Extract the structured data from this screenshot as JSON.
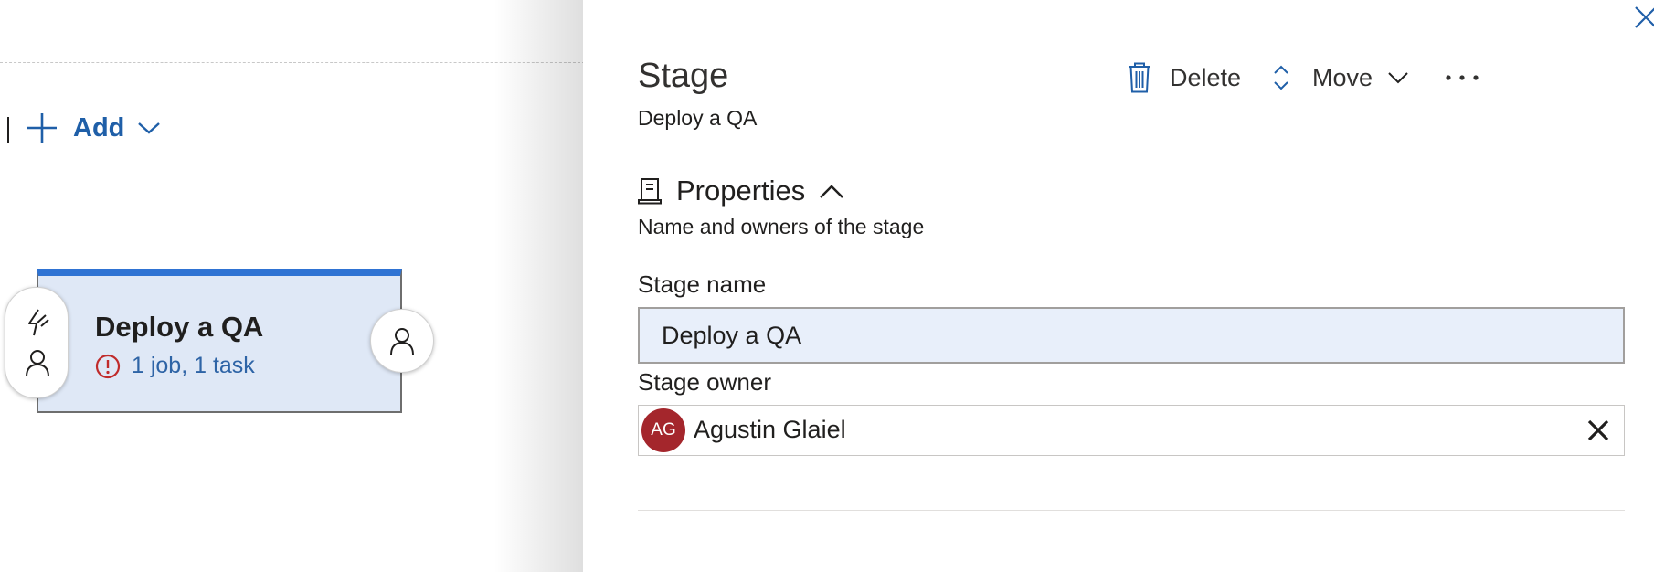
{
  "canvas": {
    "add_label": "Add",
    "stage_card": {
      "title": "Deploy a QA",
      "summary": "1 job, 1 task"
    },
    "icons": {
      "add": "plus-icon",
      "add_menu": "chevron-down-icon",
      "warning": "warning-circle-icon",
      "trigger": "lightning-icon",
      "pre_approval": "person-icon",
      "post_approval": "person-icon"
    }
  },
  "panel": {
    "title": "Stage",
    "subtitle": "Deploy a QA",
    "toolbar": {
      "delete_label": "Delete",
      "move_label": "Move"
    },
    "properties": {
      "heading": "Properties",
      "description": "Name and owners of the stage"
    },
    "stage_name": {
      "label": "Stage name",
      "value": "Deploy a QA"
    },
    "stage_owner": {
      "label": "Stage owner",
      "initials": "AG",
      "name": "Agustin Glaiel"
    }
  },
  "colors": {
    "accent": "#1f5fa8",
    "card_top": "#2f73d3",
    "card_bg": "#dfe8f6",
    "warning": "#c02b2b",
    "avatar": "#a4262c",
    "input_bg": "#e8effa"
  }
}
